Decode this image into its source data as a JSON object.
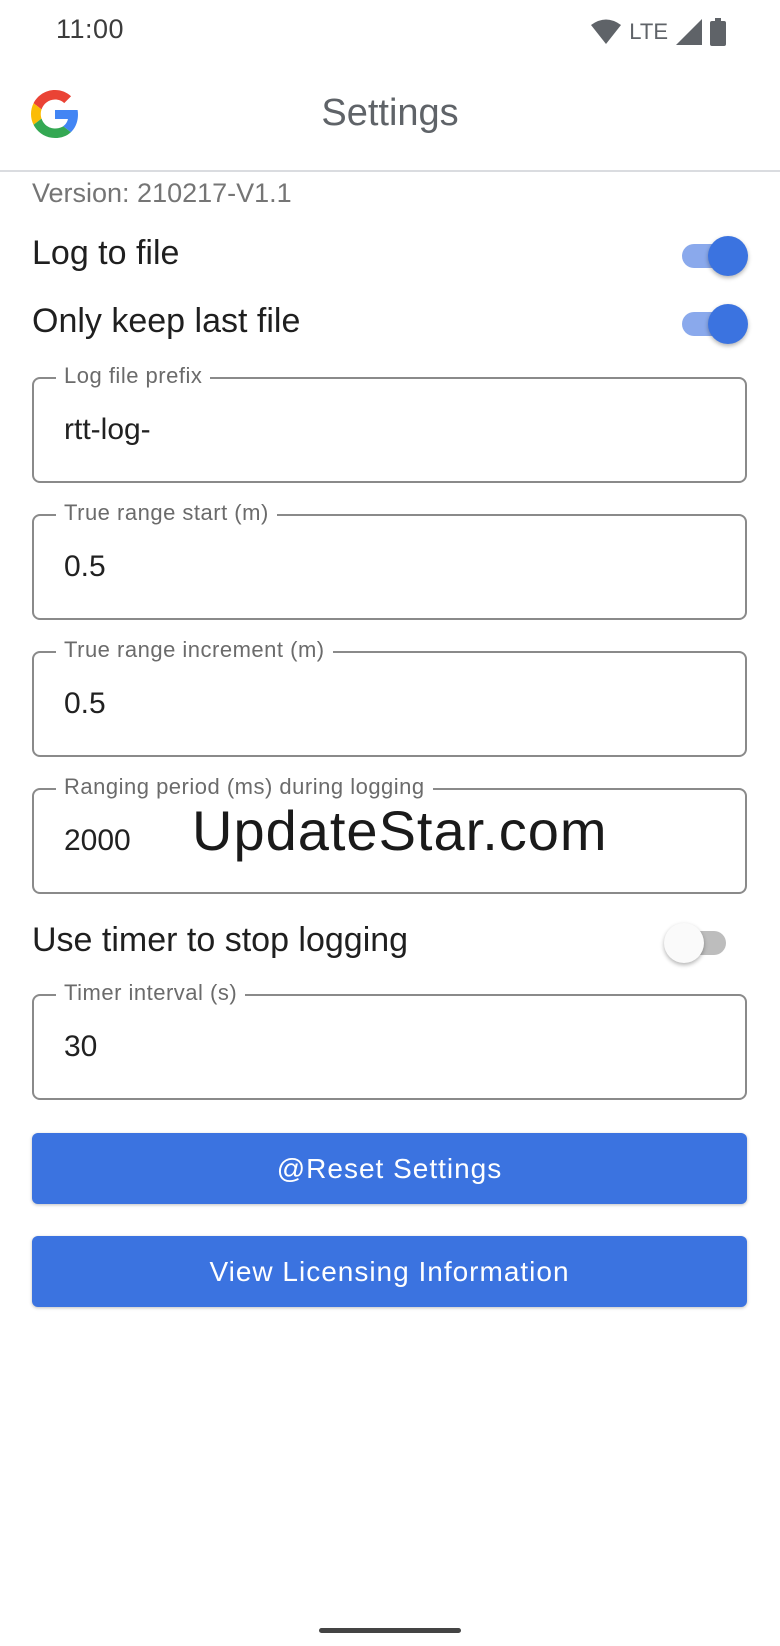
{
  "status_bar": {
    "time": "11:00",
    "network": "LTE",
    "icons": [
      "wifi-icon",
      "signal-icon",
      "battery-icon"
    ]
  },
  "app_bar": {
    "logo": "google-logo",
    "title": "Settings"
  },
  "version_text": "Version: 210217-V1.1",
  "toggles": {
    "log_to_file": {
      "label": "Log to file",
      "on": true
    },
    "only_keep_last_file": {
      "label": "Only keep last file",
      "on": true
    },
    "use_timer": {
      "label": "Use timer to stop logging",
      "on": false
    }
  },
  "fields": {
    "log_file_prefix": {
      "label": "Log file prefix",
      "value": "rtt-log-"
    },
    "true_range_start": {
      "label": "True range start (m)",
      "value": "0.5"
    },
    "true_range_increment": {
      "label": "True range increment (m)",
      "value": "0.5"
    },
    "ranging_period": {
      "label": "Ranging period (ms) during logging",
      "value": "2000"
    },
    "timer_interval": {
      "label": "Timer interval (s)",
      "value": "30"
    }
  },
  "watermark": "UpdateStar.com",
  "buttons": {
    "reset": "@Reset Settings",
    "licensing": "View Licensing Information"
  },
  "colors": {
    "accent": "#3b73e0",
    "switch_track_on": "#8aa9ec",
    "switch_track_off": "#bdbdbd"
  }
}
